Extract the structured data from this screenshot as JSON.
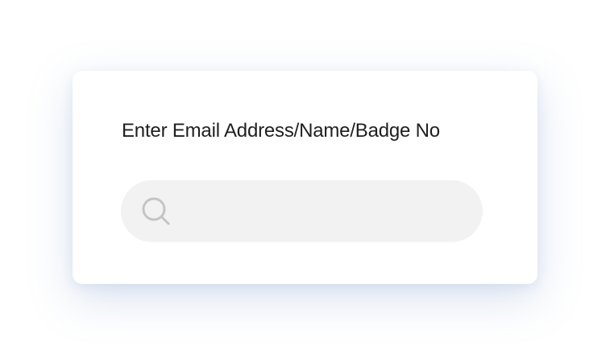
{
  "dialog": {
    "label": "Enter Email Address/Name/Badge No",
    "search": {
      "icon": "search-icon",
      "value": "",
      "placeholder": ""
    }
  },
  "colors": {
    "page_background": "#ffffff",
    "card_background": "#ffffff",
    "text": "#1f1f1f",
    "input_background": "#f2f2f2",
    "icon": "#c4c4c4"
  }
}
